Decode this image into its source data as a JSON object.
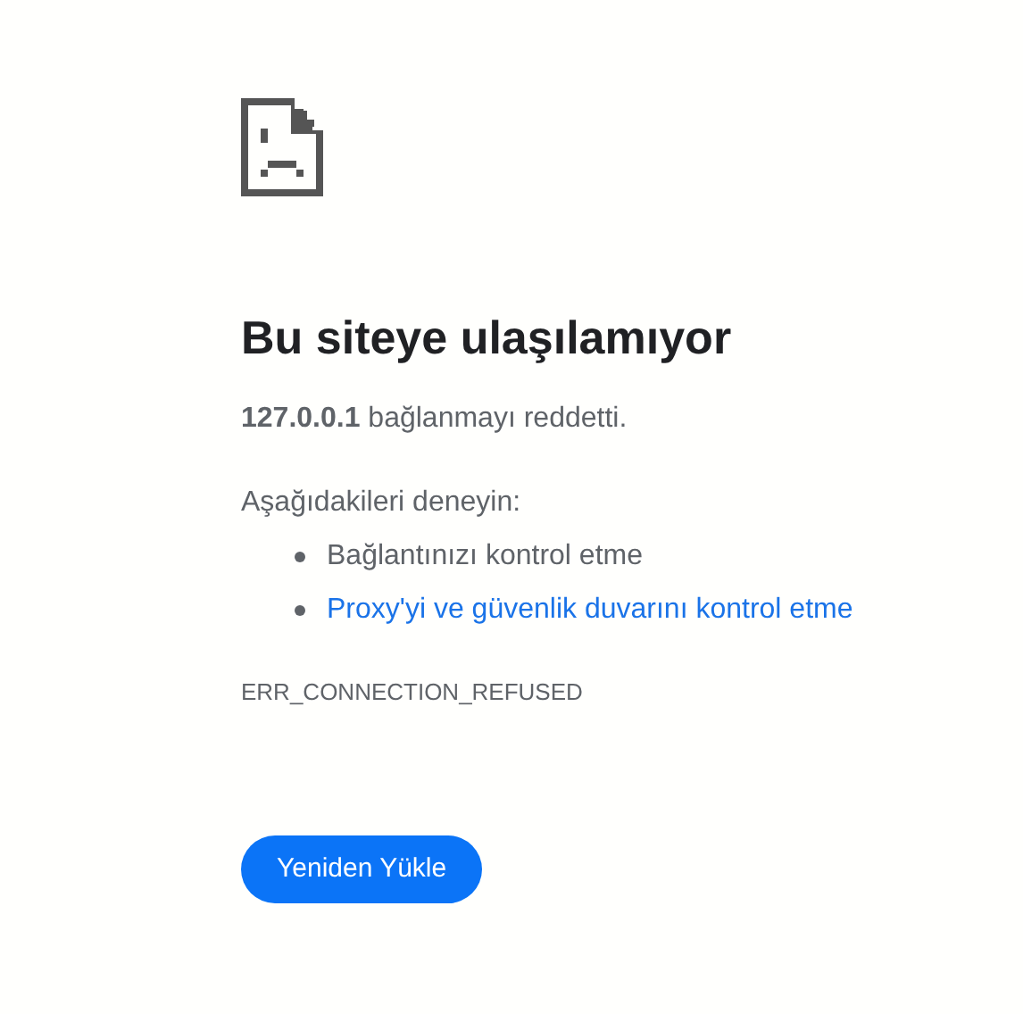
{
  "title": "Bu siteye ulaşılamıyor",
  "message": "**127.0.0.1** bağlanmayı reddetti.",
  "suggestions_heading": "Aşağıdakileri deneyin:",
  "suggestions": [
    {
      "kind": "text",
      "label": "Bağlantınızı kontrol etme"
    },
    {
      "kind": "link",
      "label": "Proxy'yi ve güvenlik duvarını kontrol etme"
    }
  ],
  "error_code": "ERR_CONNECTION_REFUSED",
  "button": "Yeniden Yükle"
}
